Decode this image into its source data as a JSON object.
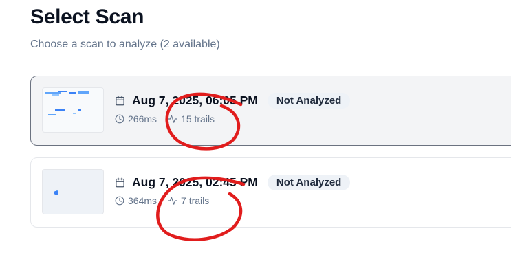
{
  "header": {
    "title": "Select Scan",
    "subtitle": "Choose a scan to analyze (2 available)"
  },
  "scans": [
    {
      "date": "Aug 7, 2025, 06:05 PM",
      "status": "Not Analyzed",
      "duration": "266ms",
      "trails": "15 trails",
      "selected": true
    },
    {
      "date": "Aug 7, 2025, 02:45 PM",
      "status": "Not Analyzed",
      "duration": "364ms",
      "trails": "7 trails",
      "selected": false
    }
  ],
  "icons": {
    "calendar": "calendar-icon",
    "clock": "clock-icon",
    "activity": "activity-icon"
  },
  "colors": {
    "thumbnail_trail": "#3b82f6",
    "annotation": "#e11d1d",
    "badge_bg": "#eef2f7",
    "selected_border": "#6b7280"
  }
}
